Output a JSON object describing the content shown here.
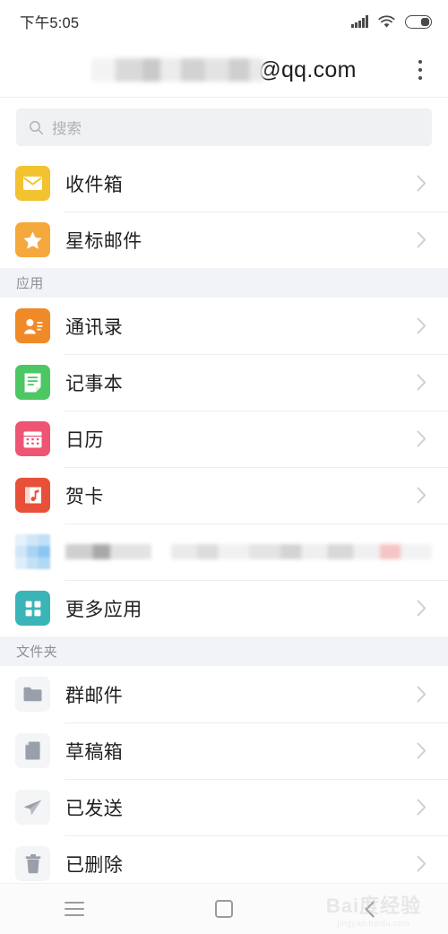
{
  "status_bar": {
    "time": "下午5:05",
    "signal_icon": "signal-bars-icon",
    "wifi_icon": "wifi-icon",
    "battery_icon": "battery-icon"
  },
  "header": {
    "account_redacted": "",
    "account_domain": "@qq.com",
    "overflow_menu_icon": "kebab-menu-icon"
  },
  "search": {
    "placeholder": "搜索",
    "value": "",
    "icon": "search-icon"
  },
  "list": [
    {
      "kind": "row",
      "label": "收件箱",
      "icon": "envelope-icon",
      "color": "#F2C230",
      "chevron": "chevron-right-icon"
    },
    {
      "kind": "row",
      "label": "星标邮件",
      "icon": "star-icon",
      "color": "#F5A83C",
      "chevron": "chevron-right-icon"
    },
    {
      "kind": "section",
      "label": "应用"
    },
    {
      "kind": "row",
      "label": "通讯录",
      "icon": "contacts-icon",
      "color": "#F08A28",
      "chevron": "chevron-right-icon"
    },
    {
      "kind": "row",
      "label": "记事本",
      "icon": "notepad-icon",
      "color": "#4CC764",
      "chevron": "chevron-right-icon"
    },
    {
      "kind": "row",
      "label": "日历",
      "icon": "calendar-icon",
      "color": "#EE5573",
      "chevron": "chevron-right-icon"
    },
    {
      "kind": "row",
      "label": "贺卡",
      "icon": "greeting-card-icon",
      "color": "#E8503A",
      "chevron": "chevron-right-icon"
    },
    {
      "kind": "redacted",
      "label": "",
      "icon": "redacted-app-icon",
      "color": "#9ECEF4"
    },
    {
      "kind": "row",
      "label": "更多应用",
      "icon": "grid-apps-icon",
      "color": "#3BB4B8",
      "chevron": "chevron-right-icon"
    },
    {
      "kind": "section",
      "label": "文件夹"
    },
    {
      "kind": "row",
      "label": "群邮件",
      "icon": "folder-icon",
      "color": "#9AA0AA",
      "chevron": "chevron-right-icon"
    },
    {
      "kind": "row",
      "label": "草稿箱",
      "icon": "document-icon",
      "color": "#9AA0AA",
      "chevron": "chevron-right-icon"
    },
    {
      "kind": "row",
      "label": "已发送",
      "icon": "paper-plane-icon",
      "color": "#9AA0AA",
      "chevron": "chevron-right-icon"
    },
    {
      "kind": "row",
      "label": "已删除",
      "icon": "trash-icon",
      "color": "#9AA0AA",
      "chevron": "chevron-right-icon"
    }
  ],
  "nav_bar": {
    "menu_icon": "menu-icon",
    "home_icon": "home-square-icon",
    "back_icon": "back-chevron-icon"
  },
  "watermark": {
    "main": "Bai度经验",
    "sub": "jingyan.baidu.com"
  },
  "colors": {
    "page_bg": "#FFFFFF",
    "section_bg": "#F1F3F6",
    "search_bg": "#F0F1F3",
    "divider": "#EEEEEE",
    "text_primary": "#1F1F1F",
    "text_muted": "#8D9096",
    "nav_bg": "#FBFBFB"
  }
}
